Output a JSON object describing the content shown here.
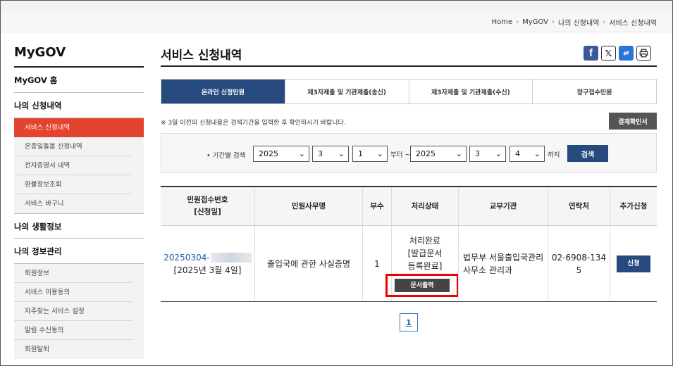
{
  "breadcrumb": [
    "Home",
    "MyGOV",
    "나의 신청내역",
    "서비스 신청내역"
  ],
  "sidebar": {
    "title": "MyGOV",
    "home": "MyGOV 홈",
    "section1": "나의 신청내역",
    "section1_items": [
      "서비스 신청내역",
      "온종일돌봄 신청내역",
      "전자증명서 내역",
      "환불정보조회",
      "서비스 바구니"
    ],
    "section2": "나의 생활정보",
    "section3": "나의 정보관리",
    "section3_items": [
      "회원정보",
      "서비스 이용동의",
      "자주찾는 서비스 설정",
      "알림 수신동의",
      "회원탈퇴"
    ]
  },
  "main": {
    "title": "서비스 신청내역",
    "tabs": [
      "온라인 신청민원",
      "제3자제출 및 기관제출(송신)",
      "제3자제출 및 기관제출(수신)",
      "창구접수민원"
    ],
    "notice": "※ 3일 이전의 신청내용은 검색기간을 입력한 후 확인하시기 바랍니다.",
    "confirm_button": "결재확인서",
    "search": {
      "label": "• 기간별 검색",
      "from_year": "2025",
      "from_month": "3",
      "from_day": "1",
      "from_text": "부터 ~",
      "to_year": "2025",
      "to_month": "3",
      "to_day": "4",
      "to_text": "까지",
      "button": "검색"
    },
    "table": {
      "headers": [
        "민원접수번호\n[신청일]",
        "민원사무명",
        "부수",
        "처리상태",
        "교부기관",
        "연락처",
        "추가신청"
      ],
      "header_receipt_line1": "민원접수번호",
      "header_receipt_line2": "[신청일]",
      "row": {
        "receipt_no": "20250304-",
        "date": "[2025년 3월 4일]",
        "name": "출입국에 관한 사실증명",
        "copies": "1",
        "status_line1": "처리완료",
        "status_line2": "[발급문서",
        "status_line3": "등록완료]",
        "print_button": "문서출력",
        "agency_line1": "법무부 서울출입국관리",
        "agency_line2": "사무소 관리과",
        "phone_line1": "02-6908-134",
        "phone_line2": "5",
        "apply_button": "신청"
      }
    },
    "pagination": {
      "current": "1"
    }
  },
  "share": {
    "facebook": "f",
    "x": "𝕏",
    "link": "🔗",
    "print": "🖶"
  }
}
